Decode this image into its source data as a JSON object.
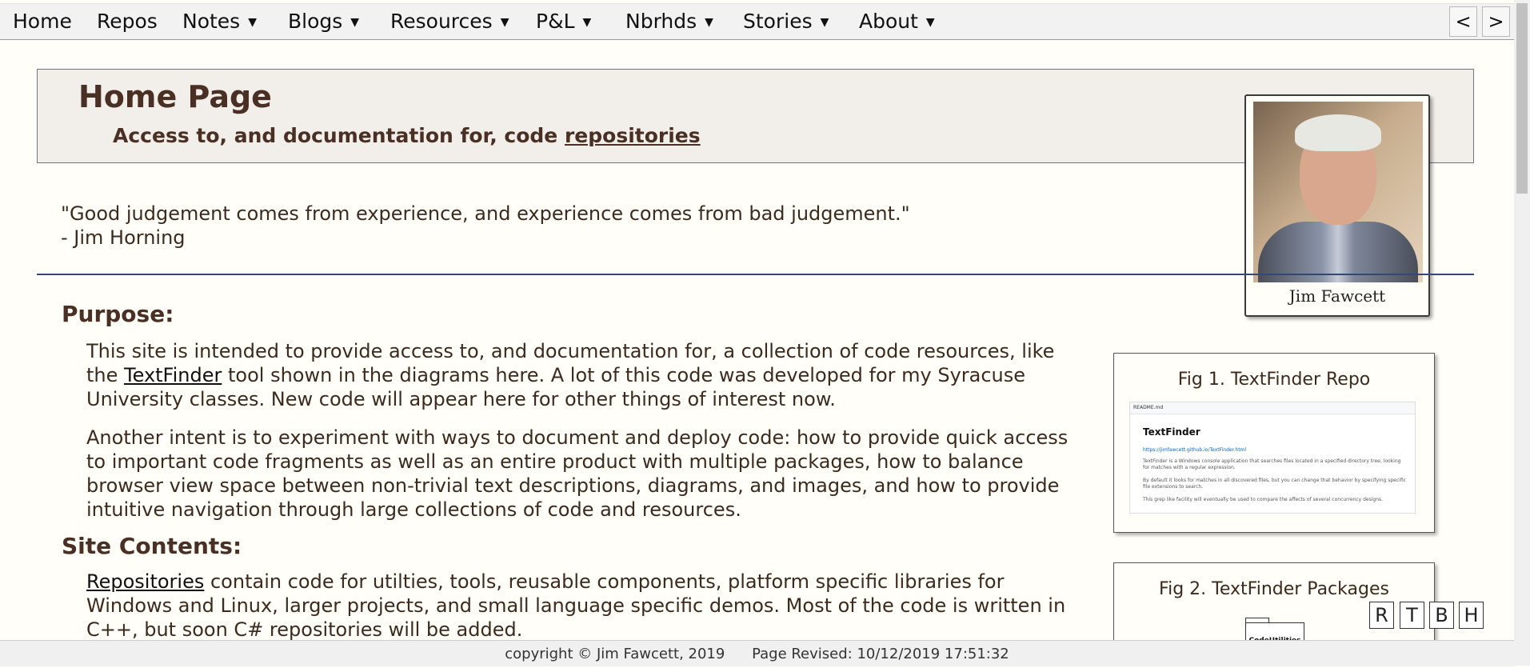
{
  "menu": {
    "items": [
      {
        "label": "Home",
        "has_dropdown": false
      },
      {
        "label": "Repos",
        "has_dropdown": false
      },
      {
        "label": "Notes",
        "has_dropdown": true
      },
      {
        "label": "Blogs",
        "has_dropdown": true
      },
      {
        "label": "Resources",
        "has_dropdown": true
      },
      {
        "label": "P&L",
        "has_dropdown": true
      },
      {
        "label": "Nbrhds",
        "has_dropdown": true
      },
      {
        "label": "Stories",
        "has_dropdown": true
      },
      {
        "label": "About",
        "has_dropdown": true
      }
    ],
    "dropdown_glyph": "▼",
    "prev_label": "<",
    "next_label": ">"
  },
  "header": {
    "title": "Home Page",
    "subtitle_prefix": "Access to, and documentation for, code ",
    "subtitle_link": "repositories"
  },
  "photo": {
    "caption": "Jim Fawcett"
  },
  "quote": {
    "text": "\"Good judgement comes from experience, and experience comes from bad judgement.\"",
    "author": "- Jim Horning"
  },
  "purpose": {
    "heading": "Purpose:",
    "p1_before": "This site is intended to provide access to, and documentation for, a collection of code resources, like the ",
    "p1_link": "TextFinder",
    "p1_after": " tool shown in the diagrams here. A lot of this code was developed for my Syracuse University classes. New code will appear here for other things of interest now.",
    "p2": "Another intent is to experiment with ways to document and deploy code: how to provide quick access to important code fragments as well as an entire product with multiple packages, how to balance browser view space between non-trivial text descriptions, diagrams, and images, and how to provide intuitive navigation through large collections of code and resources."
  },
  "site_contents": {
    "heading": "Site Contents:",
    "p1_link": "Repositories",
    "p1_after": " contain code for utilties, tools, reusable components, platform specific libraries for Windows and Linux, larger projects, and small language specific demos. Most of the code is written in C++, but soon C# repositories will be added."
  },
  "figures": [
    {
      "title": "Fig 1. TextFinder Repo",
      "readme_tab": "README.md",
      "readme_heading": "TextFinder",
      "readme_link": "https://jimfawcett.github.io/TextFinder.html",
      "readme_lines": [
        "TextFinder is a Windows console application that searches files located in a specified directory tree, looking for matches with a regular expression.",
        "By default it looks for matches in all discovered files, but you can change that behavior by specifying specific file extensions to search.",
        "This grep like facility will eventually be used to compare the affects of several concurrency designs."
      ]
    },
    {
      "title": "Fig 2. TextFinder Packages",
      "package_label": "CodeUtilities"
    }
  ],
  "float_buttons": [
    "R",
    "T",
    "B",
    "H"
  ],
  "footer": {
    "copyright": "copyright © Jim Fawcett, 2019",
    "revised": "Page Revised: 10/12/2019 17:51:32"
  }
}
